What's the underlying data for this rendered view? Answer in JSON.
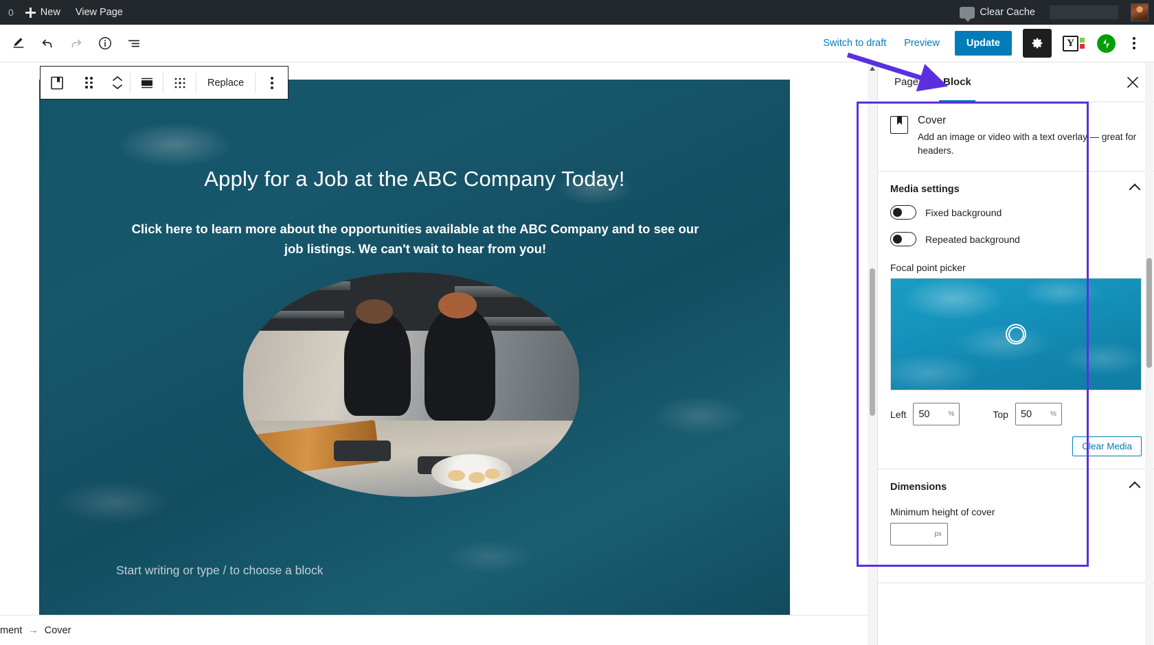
{
  "adminbar": {
    "comment_count": "0",
    "new_label": "New",
    "view_page_label": "View Page",
    "clear_cache_label": "Clear Cache",
    "comment_icon": "comment-bubble-icon",
    "avatar": "user-avatar"
  },
  "editor_header": {
    "edit_icon": "pencil-icon",
    "undo_icon": "undo-icon",
    "redo_icon": "redo-icon",
    "info_icon": "info-icon",
    "listview_icon": "list-view-icon",
    "switch_to_draft": "Switch to draft",
    "preview": "Preview",
    "update": "Update",
    "settings_icon": "gear-icon",
    "yoast_label": "Y",
    "yoast_icon": "yoast-seo-icon",
    "jetpack_icon": "jetpack-icon",
    "more_icon": "kebab-menu-icon",
    "accent_blue": "#007cba"
  },
  "block_toolbar": {
    "block_icon": "cover-block-icon",
    "drag_icon": "drag-handle-icon",
    "move_up_icon": "chevron-up-icon",
    "move_down_icon": "chevron-down-icon",
    "align_icon": "change-alignment-icon",
    "focal_icon": "content-position-icon",
    "replace_label": "Replace",
    "more_icon": "kebab-menu-icon"
  },
  "canvas": {
    "heading": "Apply for a Job at the ABC Company Today!",
    "paragraph": "Click here to learn more about the opportunities available at the ABC Company and to see our job listings. We can't wait to hear from you!",
    "placeholder": "Start writing or type / to choose a block",
    "cover_overlay_color": "#14556a"
  },
  "breadcrumb": {
    "document_label": "ment",
    "arrow": "→",
    "block_label": "Cover"
  },
  "sidebar": {
    "tabs": [
      {
        "label": "Page",
        "active": false
      },
      {
        "label": "Block",
        "active": true
      }
    ],
    "close_icon": "close-icon",
    "block_card": {
      "icon": "cover-block-icon",
      "title": "Cover",
      "description": "Add an image or video with a text overlay — great for headers."
    },
    "media_settings": {
      "title": "Media settings",
      "collapse_icon": "chevron-up-icon",
      "toggles": [
        {
          "label": "Fixed background",
          "on": false
        },
        {
          "label": "Repeated background",
          "on": false
        }
      ],
      "focal_point_label": "Focal point picker",
      "focal_handle_icon": "focal-point-handle-icon",
      "left_label": "Left",
      "left_value": "50",
      "left_unit": "%",
      "top_label": "Top",
      "top_value": "50",
      "top_unit": "%",
      "clear_media_label": "Clear Media"
    },
    "dimensions": {
      "title": "Dimensions",
      "collapse_icon": "chevron-up-icon",
      "min_height_label": "Minimum height of cover",
      "min_height_value": "",
      "min_height_unit": "px"
    }
  },
  "annotations": {
    "highlight_color": "#5a2fe0",
    "arrow_target": "Block tab"
  }
}
